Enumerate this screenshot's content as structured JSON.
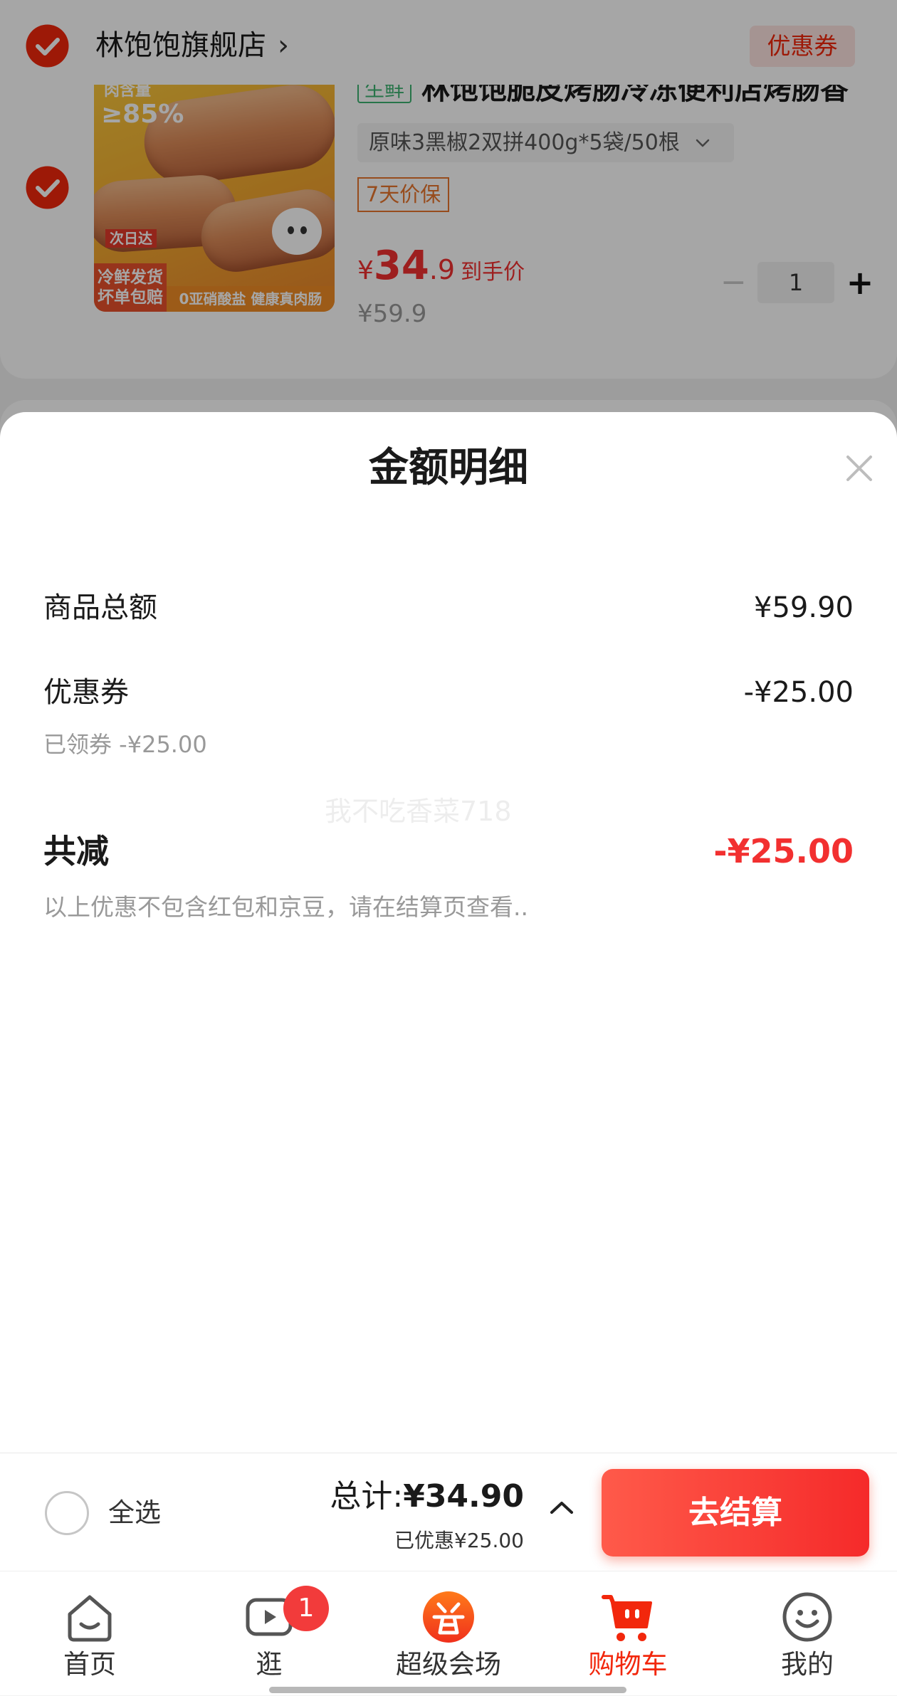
{
  "colors": {
    "brand_red": "#f2270c",
    "price_red": "#f23030",
    "tag_orange": "#e8762d",
    "tag_green": "#3cb371",
    "muted_text": "#999999",
    "button_start": "#ff5a4a",
    "button_end": "#f52a2a"
  },
  "store": {
    "selected": true,
    "name": "林饱饱旗舰店",
    "chevron": "›",
    "coupon_label": "优惠券"
  },
  "product": {
    "selected": true,
    "tag": "生鲜",
    "title": "林饱饱脆皮烤肠冷冻便利店烤肠香",
    "variant": "原味3黑椒2双拼400g*5袋/50根",
    "price_protect": "7天价保",
    "price": {
      "symbol": "¥",
      "integer": "34",
      "decimal": ".9",
      "label": "到手价"
    },
    "original_price": "¥59.9",
    "quantity": "1",
    "minus": "−",
    "plus": "+",
    "image_text": {
      "meat_label": "肉含量",
      "meat_value": "≥85%",
      "delivery": "次日达",
      "guarantee_1": "冷鲜发货",
      "guarantee_2": "坏单包赔",
      "slogan": "0亚硝酸盐 健康真肉肠"
    }
  },
  "amount_sheet": {
    "title": "金额明细",
    "rows": [
      {
        "label": "商品总额",
        "value": "¥59.90"
      },
      {
        "label": "优惠券",
        "value": "-¥25.00",
        "detail": "已领券 -¥25.00"
      }
    ],
    "total_discount": {
      "label": "共减",
      "value": "-¥25.00"
    },
    "note": "以上优惠不包含红包和京豆，请在结算页查看..",
    "watermark": "我不吃香菜718"
  },
  "checkout_bar": {
    "select_all_checked": false,
    "select_all_label": "全选",
    "total_label": "总计:",
    "total_value": "¥34.90",
    "saved_text": "已优惠¥25.00",
    "checkout_button": "去结算"
  },
  "tabs": [
    {
      "label": "首页",
      "icon": "home-icon",
      "active": false
    },
    {
      "label": "逛",
      "icon": "video-icon",
      "badge": "1",
      "active": false
    },
    {
      "label": "超级会场",
      "icon": "venue-icon",
      "active": false
    },
    {
      "label": "购物车",
      "icon": "cart-icon",
      "active": true
    },
    {
      "label": "我的",
      "icon": "profile-icon",
      "active": false
    }
  ]
}
